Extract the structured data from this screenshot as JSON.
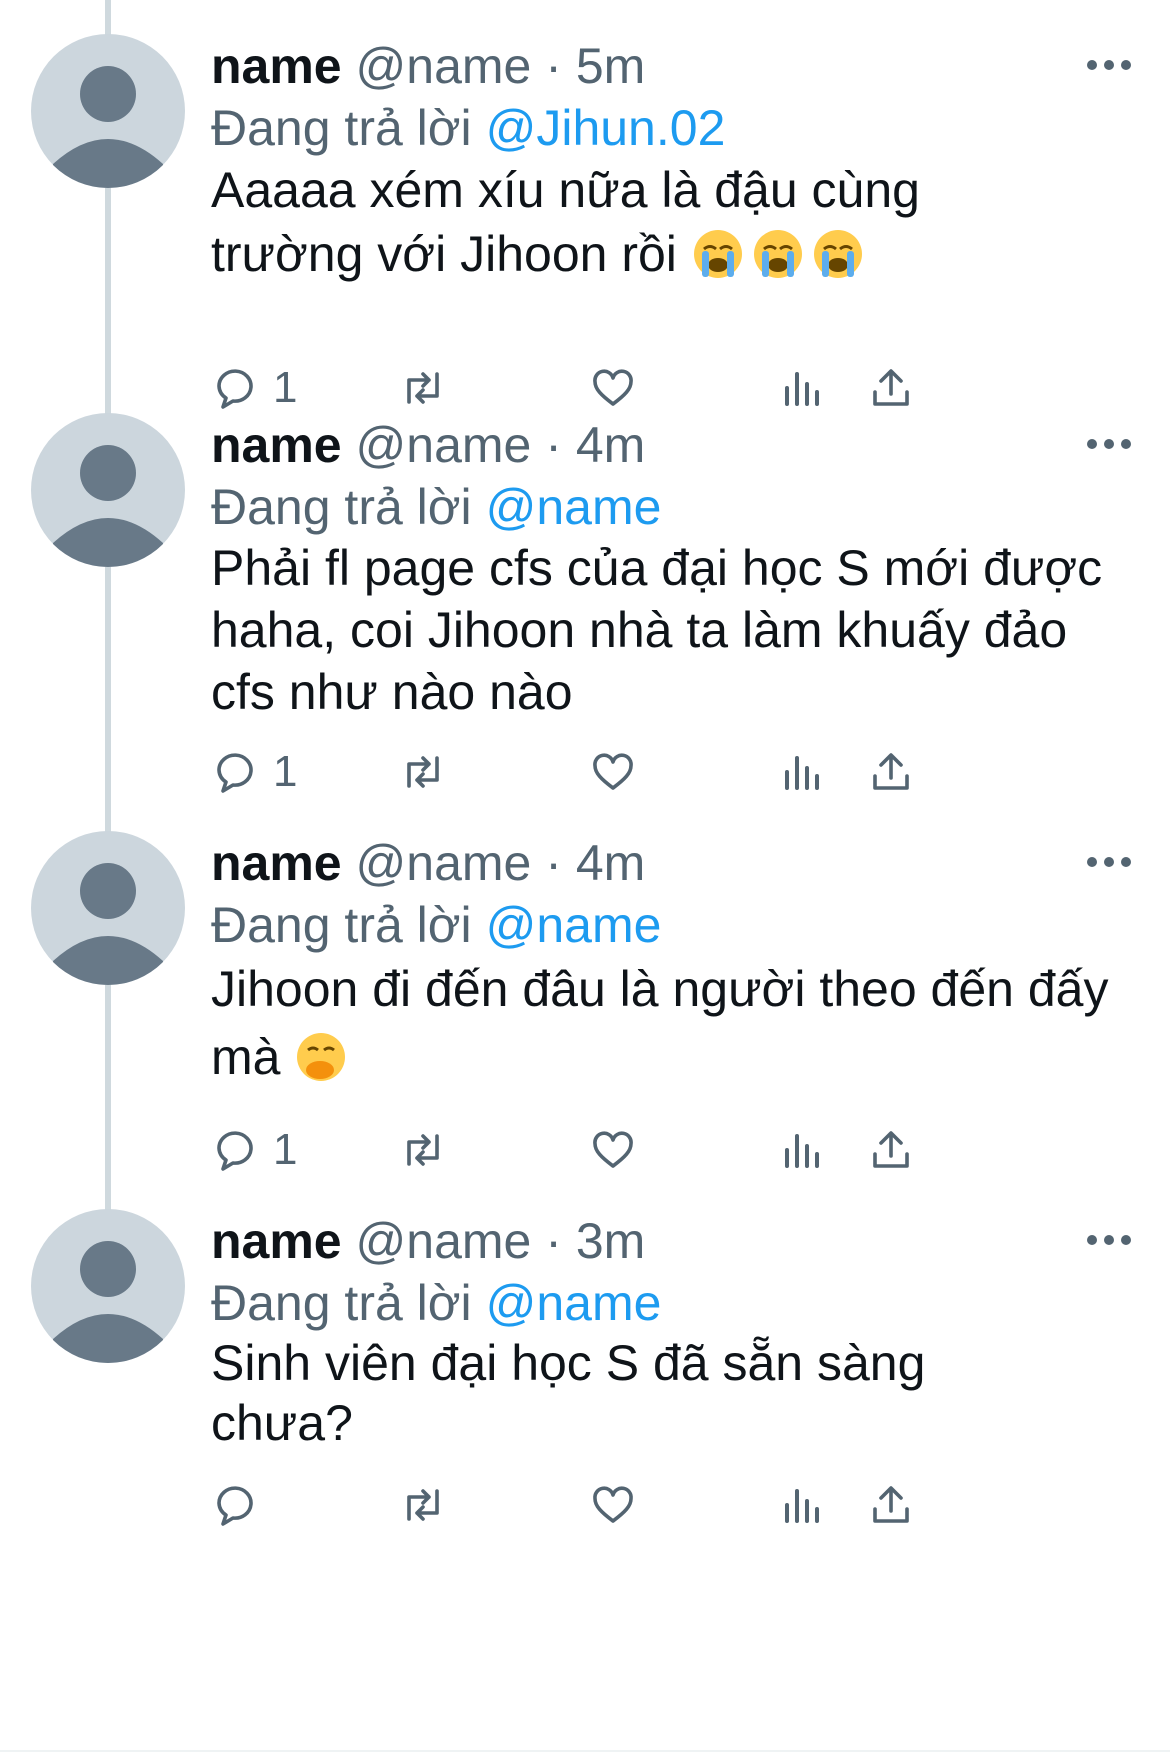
{
  "colors": {
    "accent": "#1d9bf0",
    "secondary_text": "#536471",
    "primary_text": "#0f1419",
    "thread_line": "#cfd9de",
    "avatar_bg": "#ccd6dd",
    "avatar_fg": "#687988"
  },
  "tweets": [
    {
      "display_name": "name",
      "handle": "@name",
      "separator": "·",
      "time": "5m",
      "reply_prefix": "Đang trả lời",
      "reply_to": "@Jihun.02",
      "body": "Aaaaa xém xíu nữa là đậu cùng trường với Jihoon rồi",
      "emojis": [
        "loudly-crying-face-icon",
        "loudly-crying-face-icon",
        "loudly-crying-face-icon"
      ],
      "reply_count": "1"
    },
    {
      "display_name": "name",
      "handle": "@name",
      "separator": "·",
      "time": "4m",
      "reply_prefix": "Đang trả lời",
      "reply_to": "@name",
      "body": "Phải fl page cfs của đại học S mới được haha, coi Jihoon nhà ta làm khuấy đảo cfs như nào nào",
      "emojis": [],
      "reply_count": "1"
    },
    {
      "display_name": "name",
      "handle": "@name",
      "separator": "·",
      "time": "4m",
      "reply_prefix": "Đang trả lời",
      "reply_to": "@name",
      "body": "Jihoon đi đến đâu là người theo đến đấy mà",
      "emojis": [
        "face-with-hand-over-mouth-icon"
      ],
      "reply_count": "1"
    },
    {
      "display_name": "name",
      "handle": "@name",
      "separator": "·",
      "time": "3m",
      "reply_prefix": "Đang trả lời",
      "reply_to": "@name",
      "body": "Sinh viên đại học S đã sẵn sàng chưa?",
      "emojis": [],
      "reply_count": ""
    }
  ],
  "icons": {
    "reply": "reply-icon",
    "retweet": "retweet-icon",
    "like": "heart-icon",
    "views": "views-icon",
    "share": "share-icon",
    "more": "more-icon"
  }
}
